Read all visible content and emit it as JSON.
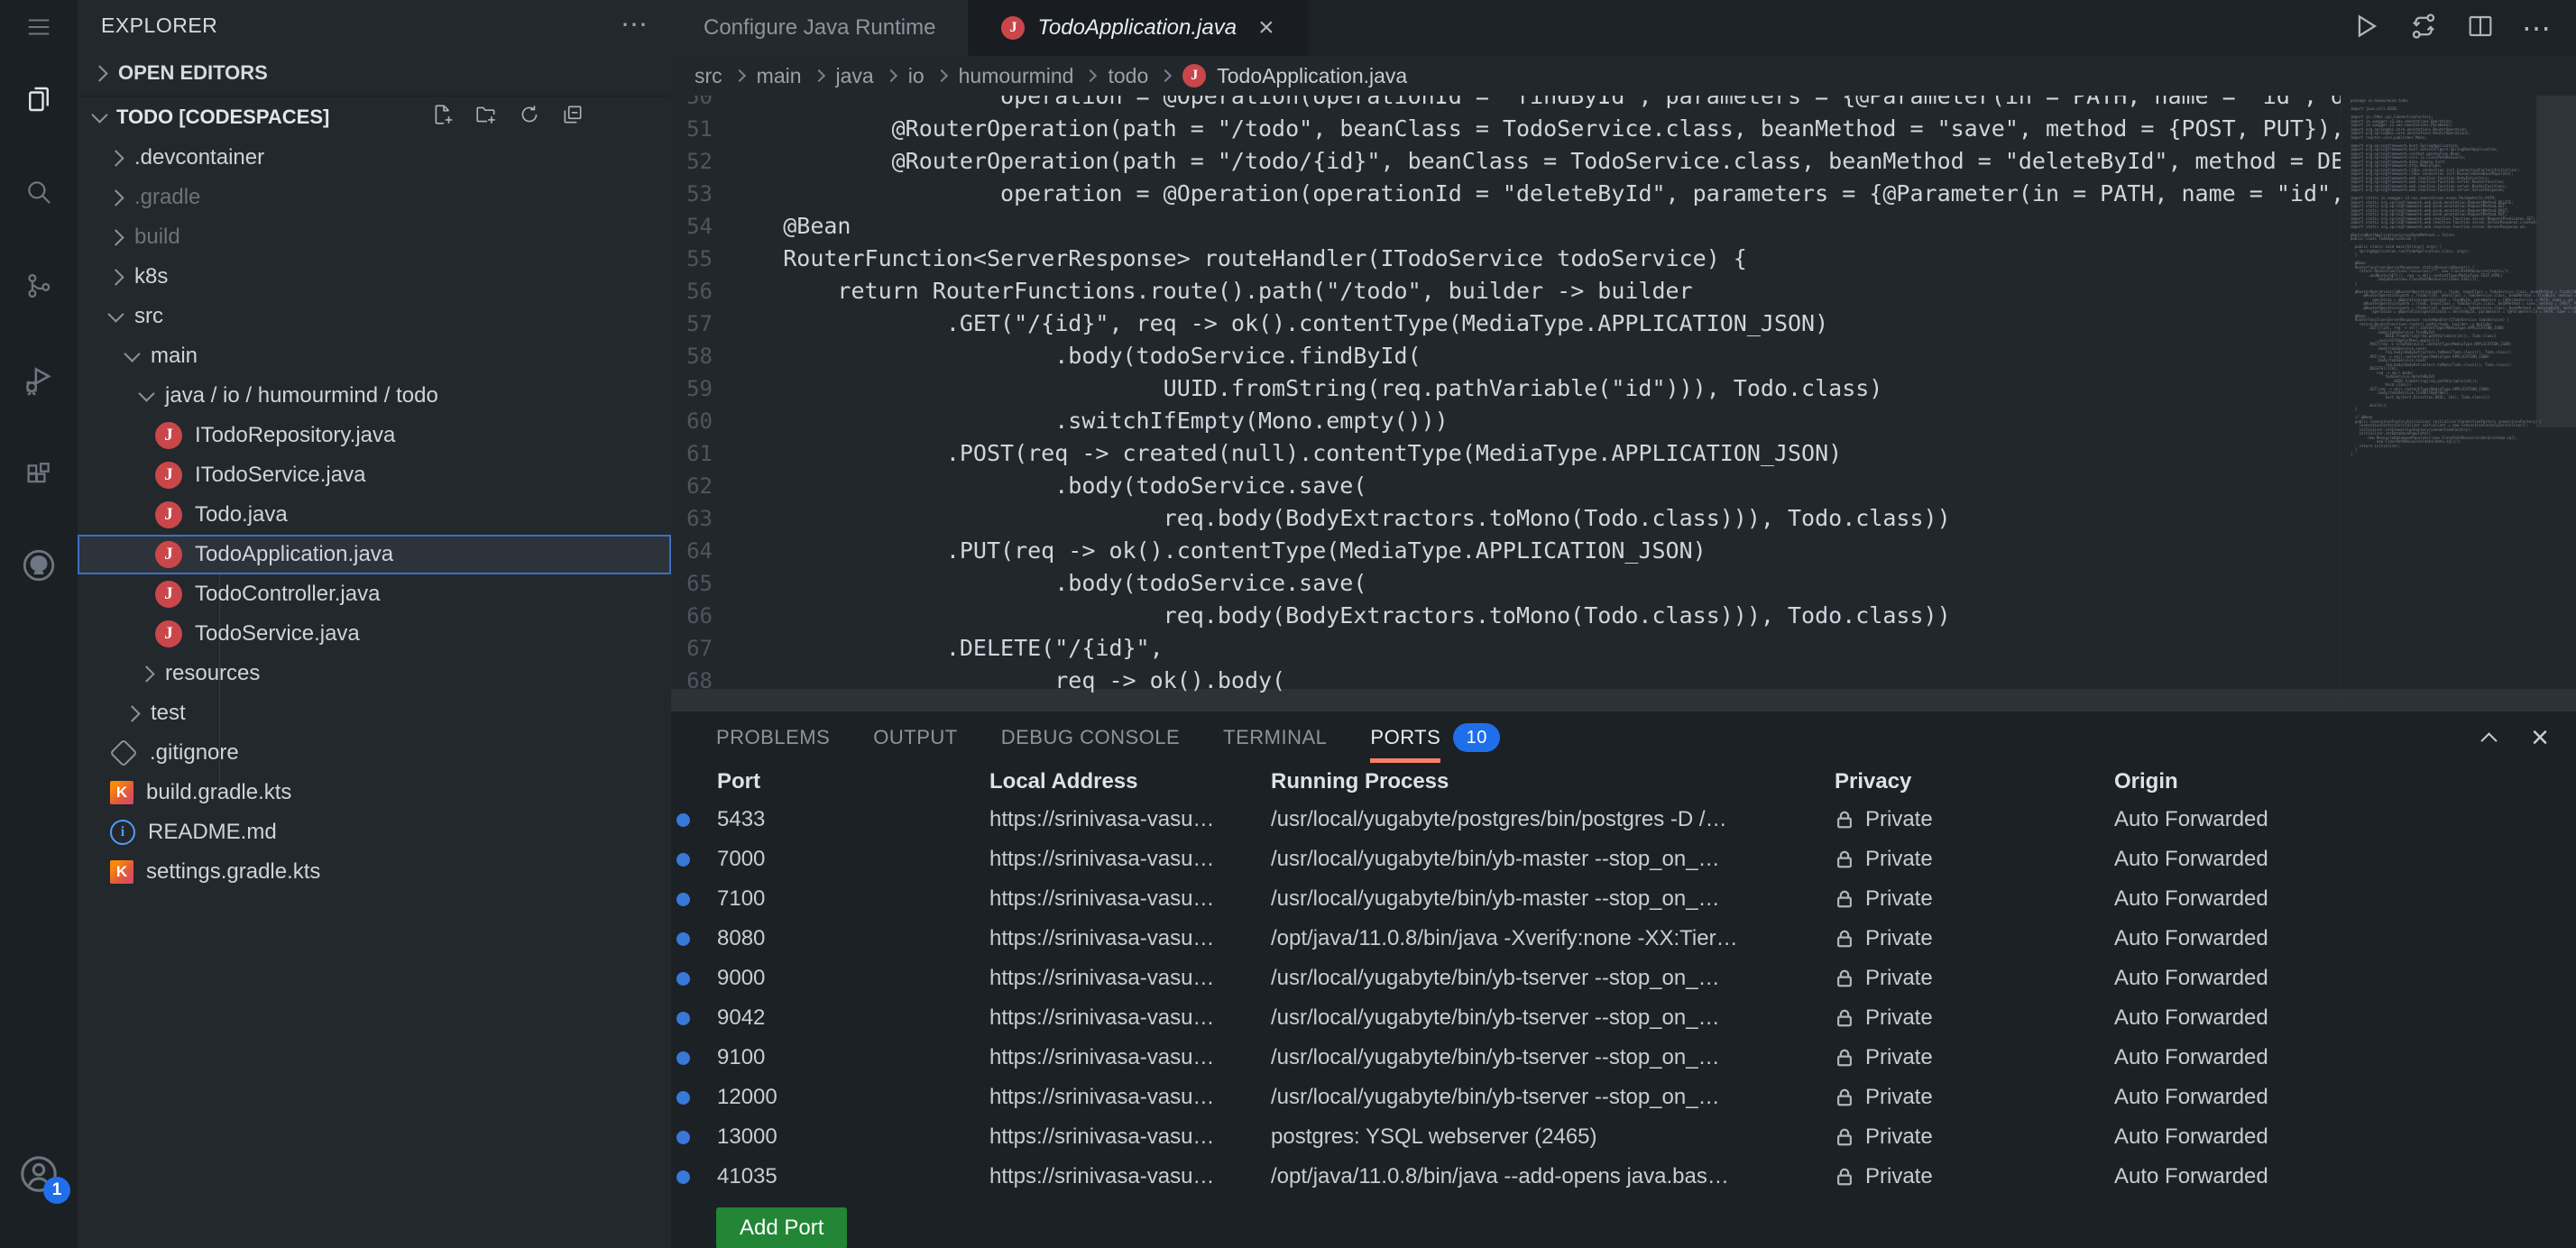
{
  "colors": {
    "accent_orange": "#f78166",
    "badge_blue": "#1f6feb",
    "port_dot_blue": "#3779d9",
    "add_button_green": "#238636",
    "java_icon_red": "#c9474a",
    "selection_border": "#3d6fc0"
  },
  "activity_bar": {
    "account_badge": "1"
  },
  "sidebar": {
    "header": {
      "title": "EXPLORER"
    },
    "sections": {
      "open_editors": "OPEN EDITORS"
    },
    "project": {
      "label": "TODO [CODESPACES]"
    },
    "tree": [
      {
        "label": ".devcontainer"
      },
      {
        "label": ".gradle"
      },
      {
        "label": "build"
      },
      {
        "label": "k8s"
      },
      {
        "label": "src"
      },
      {
        "label": "main"
      },
      {
        "label": "java / io / humourmind / todo"
      },
      {
        "label": "ITodoRepository.java"
      },
      {
        "label": "ITodoService.java"
      },
      {
        "label": "Todo.java"
      },
      {
        "label": "TodoApplication.java"
      },
      {
        "label": "TodoController.java"
      },
      {
        "label": "TodoService.java"
      },
      {
        "label": "resources"
      },
      {
        "label": "test"
      },
      {
        "label": ".gitignore"
      },
      {
        "label": "build.gradle.kts"
      },
      {
        "label": "README.md"
      },
      {
        "label": "settings.gradle.kts"
      }
    ]
  },
  "editor": {
    "tabs": [
      {
        "label": "Configure Java Runtime"
      },
      {
        "label": "TodoApplication.java",
        "close": "×"
      }
    ],
    "breadcrumb": {
      "parts": [
        "src",
        "main",
        "java",
        "io",
        "humourmind",
        "todo"
      ],
      "file": "TodoApplication.java"
    },
    "lines": [
      {
        "n": 50,
        "text": "\t\t\t\t\toperation = @Operation(operationId = \"findById\", parameters = {@Parameter(in = PATH, name = \"id\", descri"
      },
      {
        "n": 51,
        "text": "\t\t\t@RouterOperation(path = \"/todo\", beanClass = TodoService.class, beanMethod = \"save\", method = {POST, PUT}),"
      },
      {
        "n": 52,
        "text": "\t\t\t@RouterOperation(path = \"/todo/{id}\", beanClass = TodoService.class, beanMethod = \"deleteById\", method = DELETE,"
      },
      {
        "n": 53,
        "text": "\t\t\t\t\toperation = @Operation(operationId = \"deleteById\", parameters = {@Parameter(in = PATH, name = \"id\", desc"
      },
      {
        "n": 54,
        "text": "\t@Bean"
      },
      {
        "n": 55,
        "text": "\tRouterFunction<ServerResponse> routeHandler(ITodoService todoService) {"
      },
      {
        "n": 56,
        "text": "\t\treturn RouterFunctions.route().path(\"/todo\", builder -> builder"
      },
      {
        "n": 57,
        "text": "\t\t\t\t.GET(\"/{id}\", req -> ok().contentType(MediaType.APPLICATION_JSON)"
      },
      {
        "n": 58,
        "text": "\t\t\t\t\t\t.body(todoService.findById("
      },
      {
        "n": 59,
        "text": "\t\t\t\t\t\t\t\tUUID.fromString(req.pathVariable(\"id\"))), Todo.class)"
      },
      {
        "n": 60,
        "text": "\t\t\t\t\t\t.switchIfEmpty(Mono.empty()))"
      },
      {
        "n": 61,
        "text": "\t\t\t\t.POST(req -> created(null).contentType(MediaType.APPLICATION_JSON)"
      },
      {
        "n": 62,
        "text": "\t\t\t\t\t\t.body(todoService.save("
      },
      {
        "n": 63,
        "text": "\t\t\t\t\t\t\t\treq.body(BodyExtractors.toMono(Todo.class))), Todo.class))"
      },
      {
        "n": 64,
        "text": "\t\t\t\t.PUT(req -> ok().contentType(MediaType.APPLICATION_JSON)"
      },
      {
        "n": 65,
        "text": "\t\t\t\t\t\t.body(todoService.save("
      },
      {
        "n": 66,
        "text": "\t\t\t\t\t\t\t\treq.body(BodyExtractors.toMono(Todo.class))), Todo.class))"
      },
      {
        "n": 67,
        "text": "\t\t\t\t.DELETE(\"/{id}\","
      },
      {
        "n": 68,
        "text": "\t\t\t\t\t\treq -> ok().body("
      }
    ],
    "minimap_text": "package io.humourmind.todo;\n\nimport java.util.UUID;\n\nimport io.r2dbc.spi.ConnectionFactory;\nimport io.swagger.v3.oas.annotations.Operation;\nimport io.swagger.v3.oas.annotations.Parameter;\nimport org.springdoc.core.annotations.RouterOperation;\nimport org.springdoc.core.annotations.RouterOperations;\nimport reactor.core.publisher.Mono;\n\nimport org.springframework.boot.SpringApplication;\nimport org.springframework.boot.autoconfigure.SpringBootApplication;\nimport org.springframework.context.annotation.Bean;\nimport org.springframework.core.io.ClassPathResource;\nimport org.springframework.data.domain.Sort;\nimport org.springframework.http.MediaType;\nimport org.springframework.r2dbc.connection.init.ConnectionFactoryInitializer;\nimport org.springframework.r2dbc.connection.init.ResourceDatabasePopulator;\nimport org.springframework.web.reactive.function.BodyExtractors;\nimport org.springframework.web.reactive.function.server.RouterFunction;\nimport org.springframework.web.reactive.function.server.RouterFunctions;\nimport org.springframework.web.reactive.function.server.ServerResponse;\n\nimport static io.swagger.v3.oas.annotations.enums.ParameterIn.PATH;\nimport static org.springframework.web.bind.annotation.RequestMethod.DELETE;\nimport static org.springframework.web.bind.annotation.RequestMethod.GET;\nimport static org.springframework.web.bind.annotation.RequestMethod.POST;\nimport static org.springframework.web.bind.annotation.RequestMethod.PUT;\nimport static org.springframework.web.reactive.function.server.RequestPredicates.GET;\nimport static org.springframework.web.reactive.function.server.ServerResponse.created;\nimport static org.springframework.web.reactive.function.server.ServerResponse.ok;\n\n@SpringBootApplication(proxyBeanMethods = false)\npublic class TodoApplication {\n\n\tpublic static void main(String[] args) {\n\t\tSpringApplication.run(TodoApplication.class, args);\n\t}\n\n\t@Bean\n\tRouterFunction<ServerResponse> staticResourceRouter() {\n\t\treturn RouterFunctions.resources(/**, new ClassPathResource(static/))\n\t\t\t\t.andRoute(GET(/), req -> ok().contentType(MediaType.TEXT_HTML)\n\t\t\t\t\t\t.bodyValue(new ClassPathResource(index.html)));\n\t}\n\n\t@RouterOperations({@RouterOperation(path = /todo, beanClass = TodoService.class, beanMethod = findAllByDate),\n\t\t\t@RouterOperation(path = /todo/{id}, beanClass = TodoService.class, beanMethod = findById, method = GET,\n\t\t\t\t\toperation = @Operation(operationId = findById, parameters = {@Parameter(in = PATH, name = id,\n\t\t\t@RouterOperation(path = /todo, beanClass = TodoService.class, beanMethod = save, method = {POST, PUT}),\n\t\t\t@RouterOperation(path = /todo/{id}, beanClass = TodoService.class, beanMethod = deleteById, method = DELETE,\n\t\t\t\t\toperation = @Operation(operationId = deleteById, parameters = {@Parameter(in = PATH, name = id,\n\t@Bean\n\tRouterFunction<ServerResponse> routeHandler(ITodoService todoService) {\n\t\treturn RouterFunctions.route().path(/todo, builder -> builder\n\t\t\t\t.GET(/{id}, req -> ok().contentType(MediaType.APPLICATION_JSON)\n\t\t\t\t\t\t.body(todoService.findById(\n\t\t\t\t\t\t\t\tUUID.fromString(req.pathVariable(id))), Todo.class)\n\t\t\t\t\t\t.switchIfEmpty(Mono.empty()))\n\t\t\t\t.POST(req -> created(null).contentType(MediaType.APPLICATION_JSON)\n\t\t\t\t\t\t.body(todoService.save(\n\t\t\t\t\t\t\t\treq.body(BodyExtractors.toMono(Todo.class))), Todo.class))\n\t\t\t\t.PUT(req -> ok().contentType(MediaType.APPLICATION_JSON)\n\t\t\t\t\t\t.body(todoService.save(\n\t\t\t\t\t\t\t\treq.body(BodyExtractors.toMono(Todo.class))), Todo.class))\n\t\t\t\t.DELETE(/{id},\n\t\t\t\t\t\treq -> ok().body(\n\t\t\t\t\t\t\t\ttodoService.deleteById(\n\t\t\t\t\t\t\t\t\t\tUUID.fromString(req.pathVariable(id))),\n\t\t\t\t\t\t\t\tVoid.class))\n\t\t\t\t.GET(req -> ok().contentType(MediaType.APPLICATION_JSON)\n\t\t\t\t\t\t.body(todoService.findAllByOrder(\n\t\t\t\t\t\t\t\tSort.by(Sort.Direction.DESC, id)), Todo.class)))\n\n\t\t\t\t.build();\n\t}\n\n\t// @Bean\n\tpublic ConnectionFactoryInitializer initializer(ConnectionFactory connectionFactory) {\n\t\tConnectionFactoryInitializer initializer = new ConnectionFactoryInitializer();\n\t\tinitializer.setConnectionFactory(connectionFactory);\n\t\tinitializer.setDatabasePopulator(\n\t\t\t\tnew ResourceDatabasePopulator(new ClassPathResource(data/schema.sql),\n\t\t\t\t\t\tnew ClassPathResource(data/data.sql)));\n\t\treturn initializer;\n\t}\n}"
  },
  "panel": {
    "tabs": [
      {
        "label": "PROBLEMS"
      },
      {
        "label": "OUTPUT"
      },
      {
        "label": "DEBUG CONSOLE"
      },
      {
        "label": "TERMINAL"
      },
      {
        "label": "PORTS"
      }
    ],
    "ports_badge": "10",
    "table": {
      "headers": [
        "Port",
        "Local Address",
        "Running Process",
        "Privacy",
        "Origin"
      ],
      "rows": [
        {
          "port": "5433",
          "local": "https://srinivasa-vasu…",
          "process": "/usr/local/yugabyte/postgres/bin/postgres -D /…",
          "privacy": "Private",
          "origin": "Auto Forwarded"
        },
        {
          "port": "7000",
          "local": "https://srinivasa-vasu…",
          "process": "/usr/local/yugabyte/bin/yb-master --stop_on_…",
          "privacy": "Private",
          "origin": "Auto Forwarded"
        },
        {
          "port": "7100",
          "local": "https://srinivasa-vasu…",
          "process": "/usr/local/yugabyte/bin/yb-master --stop_on_…",
          "privacy": "Private",
          "origin": "Auto Forwarded"
        },
        {
          "port": "8080",
          "local": "https://srinivasa-vasu…",
          "process": "/opt/java/11.0.8/bin/java -Xverify:none -XX:Tier…",
          "privacy": "Private",
          "origin": "Auto Forwarded"
        },
        {
          "port": "9000",
          "local": "https://srinivasa-vasu…",
          "process": "/usr/local/yugabyte/bin/yb-tserver --stop_on_…",
          "privacy": "Private",
          "origin": "Auto Forwarded"
        },
        {
          "port": "9042",
          "local": "https://srinivasa-vasu…",
          "process": "/usr/local/yugabyte/bin/yb-tserver --stop_on_…",
          "privacy": "Private",
          "origin": "Auto Forwarded"
        },
        {
          "port": "9100",
          "local": "https://srinivasa-vasu…",
          "process": "/usr/local/yugabyte/bin/yb-tserver --stop_on_…",
          "privacy": "Private",
          "origin": "Auto Forwarded"
        },
        {
          "port": "12000",
          "local": "https://srinivasa-vasu…",
          "process": "/usr/local/yugabyte/bin/yb-tserver --stop_on_…",
          "privacy": "Private",
          "origin": "Auto Forwarded"
        },
        {
          "port": "13000",
          "local": "https://srinivasa-vasu…",
          "process": "postgres: YSQL webserver (2465)",
          "privacy": "Private",
          "origin": "Auto Forwarded"
        },
        {
          "port": "41035",
          "local": "https://srinivasa-vasu…",
          "process": "/opt/java/11.0.8/bin/java --add-opens java.bas…",
          "privacy": "Private",
          "origin": "Auto Forwarded"
        }
      ]
    },
    "add_port_label": "Add Port"
  }
}
